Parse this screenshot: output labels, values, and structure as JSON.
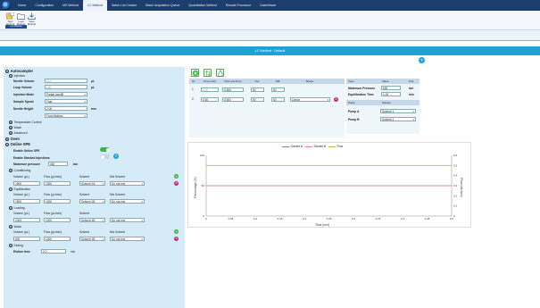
{
  "tabs": [
    "Home",
    "Configuration",
    "MS Method",
    "LC Method",
    "Batch List Creator",
    "Batch Acquisition Queue",
    "Quantitation Method",
    "Results Processor",
    "DataViewer"
  ],
  "ribbon": {
    "buttons": [
      {
        "label": "New Method",
        "icon": "new-method-icon"
      },
      {
        "label": "Load Method",
        "icon": "load-method-icon"
      },
      {
        "label": "Save Method",
        "icon": "save-method-icon"
      }
    ],
    "group_label": "LC Method"
  },
  "title": "LC Method : Default",
  "colors": {
    "accent": "#1ba3d8",
    "tabbar": "#1c3d6e",
    "panel": "#d5ebf7",
    "green": "#3db44a",
    "magenta": "#c0287c"
  },
  "left": {
    "autosampler": "Autosampler",
    "injection": "Injection",
    "needle_volume": {
      "label": "Needle Volume",
      "value": "10.0",
      "unit": "µL"
    },
    "loop_volume": {
      "label": "Loop Volume",
      "value": "100",
      "unit": "µL"
    },
    "injection_mode": {
      "label": "Injection Mode",
      "value": "Partial loopfill"
    },
    "sample_speed": {
      "label": "Sample Speed",
      "value": "Fast"
    },
    "needle_height": {
      "label": "Needle Height",
      "value": "2.00",
      "unit": "mm"
    },
    "from_bottom": "From Bottom",
    "temperature_control": "Temperature Control",
    "wash": "Wash",
    "advanced": "Advanced",
    "oven": "Oven",
    "online_spe": "Online SPE",
    "enable_online_spe": "Enable Online SPE",
    "enable_stacked": "Enable Stacked Injections",
    "max_pressure": {
      "label": "Maximum pressure",
      "value": "400",
      "unit": "bar"
    },
    "conditioning": "Conditioning",
    "equilibration": "Equilibration",
    "loading": "Loading",
    "wash2": "Wash",
    "eluting": "Eluting",
    "col_headers": [
      "Volume (µL)",
      "Flow (µL/min)",
      "Solvent",
      "Mix Solvent"
    ],
    "col_headers_short": [
      "Volume (µL)",
      "Flow (µL/min)",
      "Solvent"
    ],
    "rows": {
      "conditioning": [
        "1500",
        "1000",
        "Solvent 1A",
        "Do not mix"
      ],
      "equilibration": [
        "1500",
        "1000",
        "Solvent 1B",
        "Do not mix"
      ],
      "loading": [
        "1000",
        "1000",
        "Solvent 1B",
        "Do not mix"
      ],
      "wash": [
        "500",
        "1000",
        "Solvent 1B",
        "Do not mix"
      ]
    },
    "elution_time": {
      "label": "Elution time",
      "value": "2.0",
      "unit": "min"
    }
  },
  "gradient": {
    "headers": [
      "Nr.",
      "Time (min)",
      "Flow (mL/min)",
      "%A",
      "%B",
      "Shape"
    ],
    "rows": [
      {
        "nr": "1",
        "time": "0.00",
        "flow": "0.500",
        "a": "50",
        "b": "50",
        "shape": ""
      },
      {
        "nr": "2",
        "time": "0.50",
        "flow": "0.500",
        "a": "50",
        "b": "50",
        "shape": "Linear"
      }
    ]
  },
  "type_table": {
    "headers": [
      "Type",
      "Value",
      "Unit"
    ],
    "rows": [
      [
        "Maximum Pressure",
        "690",
        "bar"
      ],
      [
        "Equilibration Time",
        "1.00",
        "min"
      ]
    ],
    "pump_headers": [
      "Pump",
      "Solvent"
    ],
    "pumps": [
      [
        "Pump A",
        "Solvent 1"
      ],
      [
        "Pump B",
        "Solvent 1"
      ]
    ]
  },
  "chart_data": {
    "type": "line",
    "legend": [
      "Solvent A",
      "Solvent B",
      "Flow"
    ],
    "legend_position": "top-center",
    "colors": [
      "#6d7fcc",
      "#e8828a",
      "#8fd14f"
    ],
    "x": [
      0,
      0.5
    ],
    "series": [
      {
        "name": "Solvent A",
        "values": [
          50,
          50
        ]
      },
      {
        "name": "Solvent B",
        "values": [
          50,
          50
        ]
      },
      {
        "name": "Flow",
        "values": [
          0.5,
          0.5
        ]
      }
    ],
    "xlabel": "Time (min)",
    "ylabel": "Percentage (%)",
    "y2label": "Flow (mL/min)",
    "xlim": [
      0,
      0.5
    ],
    "ylim": [
      0,
      100
    ],
    "y2lim": [
      0,
      0.6
    ],
    "xticks": [
      "0",
      "0.05",
      "0.1",
      "0.15",
      "0.2",
      "0.25",
      "0.3",
      "0.35",
      "0.4",
      "0.45",
      "0.5"
    ],
    "yticks": [
      "100",
      "50",
      "0"
    ],
    "y2ticks": [
      "0.6",
      "0.5",
      "0.4",
      "0.3",
      "0.2",
      "0.1",
      "0"
    ],
    "grid": false
  }
}
